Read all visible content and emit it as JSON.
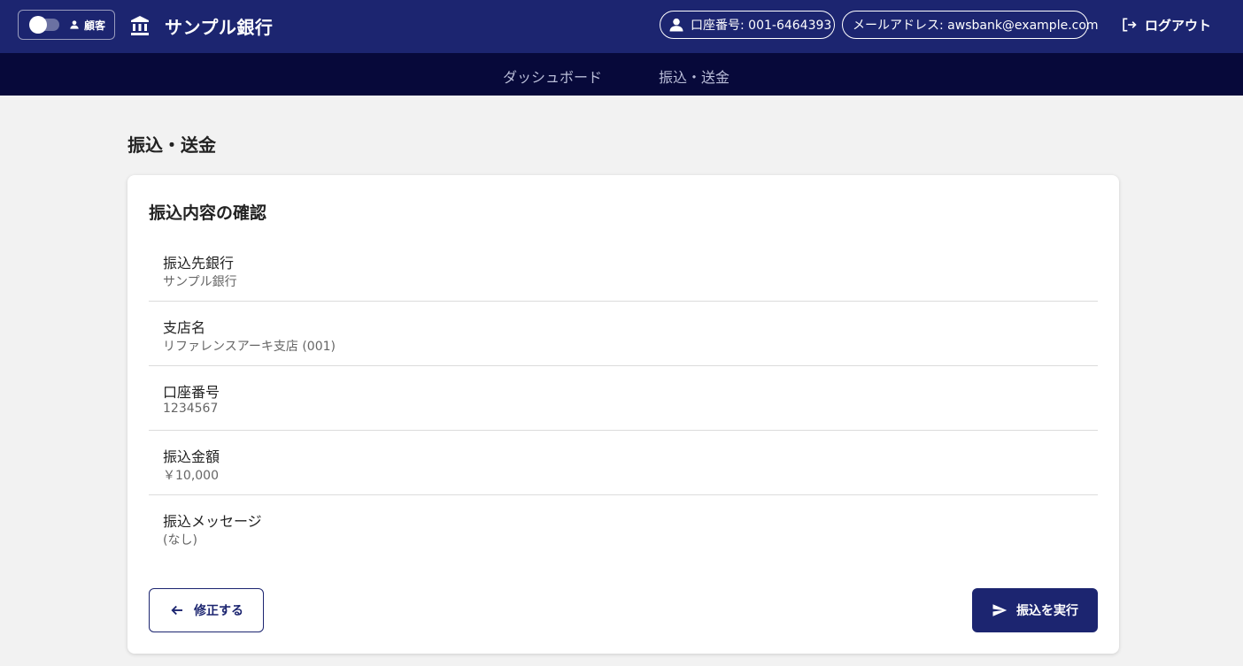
{
  "header": {
    "role_label": "顧客",
    "bank_name": "サンプル銀行",
    "account_pill": "口座番号: 001-6464393",
    "email_pill": "メールアドレス: awsbank@example.com",
    "logout_label": "ログアウト"
  },
  "nav": {
    "tabs": [
      {
        "label": "ダッシュボード"
      },
      {
        "label": "振込・送金"
      }
    ]
  },
  "main": {
    "page_title": "振込・送金",
    "card_title": "振込内容の確認",
    "details": [
      {
        "label": "振込先銀行",
        "value": "サンプル銀行"
      },
      {
        "label": "支店名",
        "value": "リファレンスアーキ支店 (001)"
      },
      {
        "label": "口座番号",
        "value": "1234567"
      },
      {
        "label": "振込金額",
        "value": "￥10,000"
      },
      {
        "label": "振込メッセージ",
        "value": "(なし)"
      }
    ],
    "back_button": "修正する",
    "submit_button": "振込を実行"
  },
  "colors": {
    "header_bg": "#1c2570",
    "subnav_bg": "#07093a",
    "accent": "#1c2570",
    "page_bg": "#f2f2f2"
  },
  "icons": {
    "bank": "bank-icon",
    "person": "person-icon",
    "logout": "logout-icon",
    "back": "arrow-left-icon",
    "send": "send-icon"
  }
}
